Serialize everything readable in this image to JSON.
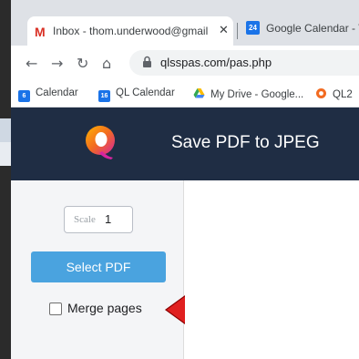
{
  "browser": {
    "tabs": [
      {
        "title": "Inbox - thom.underwood@gmail",
        "close": "✕"
      },
      {
        "title": "Google Calendar - Wee",
        "icon_text": "24"
      }
    ],
    "url": "qlsspas.com/pas.php",
    "bookmarks": [
      {
        "label": "Calendar",
        "icon_text": "6"
      },
      {
        "label": "QL Calendar",
        "icon_text": "16"
      },
      {
        "label": "My Drive - Google..."
      },
      {
        "label": "QL2"
      }
    ]
  },
  "app": {
    "title": "Save PDF to JPEG",
    "scale_label": "Scale",
    "scale_value": "1",
    "select_button": "Select PDF",
    "merge_label": "Merge pages",
    "merge_checked": false,
    "header_color": "#1f2d44",
    "button_color": "#4aa3df",
    "arrow_color": "#e02020"
  }
}
